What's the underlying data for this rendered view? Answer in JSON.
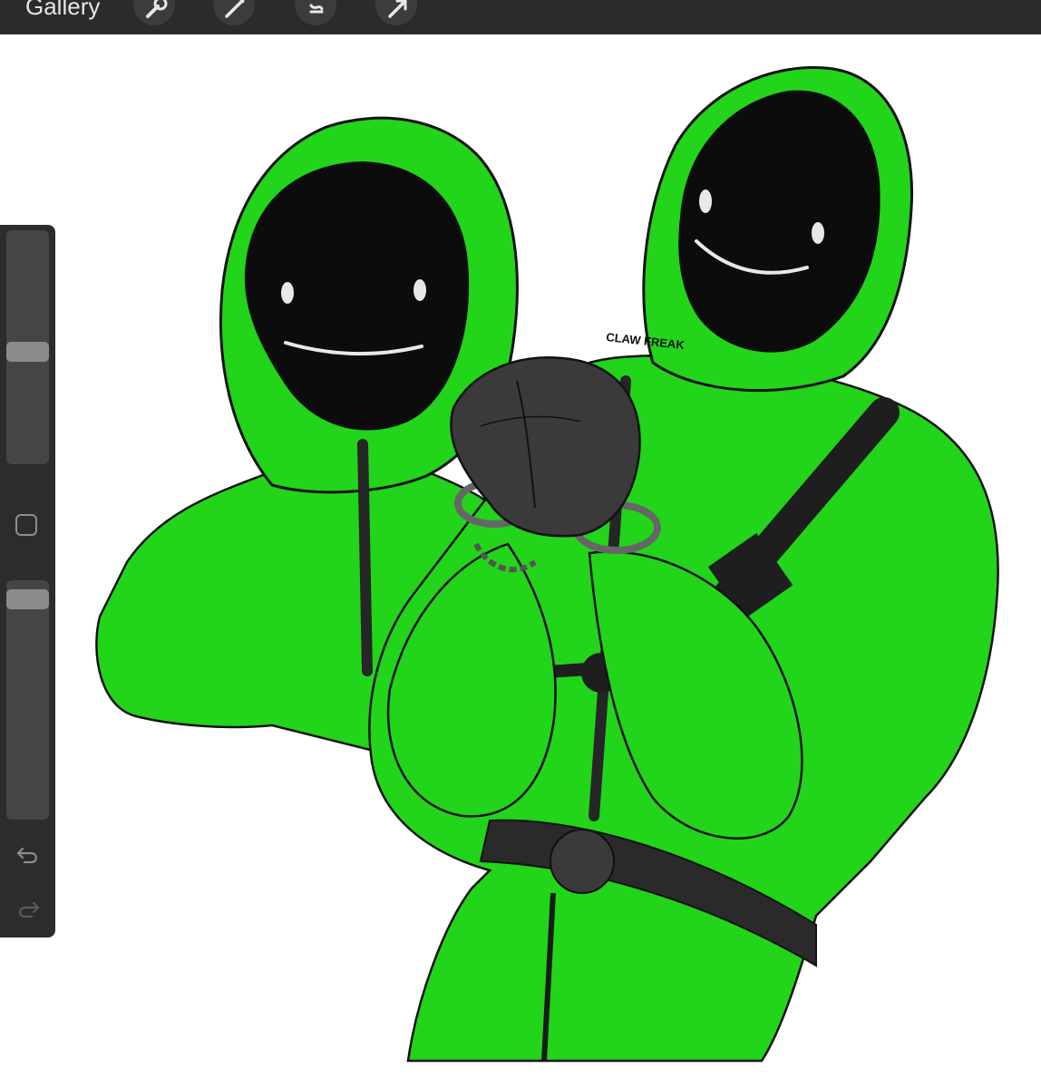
{
  "topbar": {
    "gallery_label": "Gallery",
    "tools": [
      {
        "name": "wrench-icon"
      },
      {
        "name": "magic-wand-icon"
      },
      {
        "name": "selection-icon"
      },
      {
        "name": "transform-arrow-icon"
      }
    ]
  },
  "sidebar": {
    "brush_size": 0.48,
    "brush_opacity": 0.04
  },
  "artwork": {
    "signature": "CLAW FREAK"
  },
  "colors": {
    "topbar": "#2b2b2b",
    "sidebar": "#2c2c2c",
    "suit_green": "#22d41a",
    "mask_black": "#0c0c0c",
    "glove_gray": "#3a3a3a"
  }
}
